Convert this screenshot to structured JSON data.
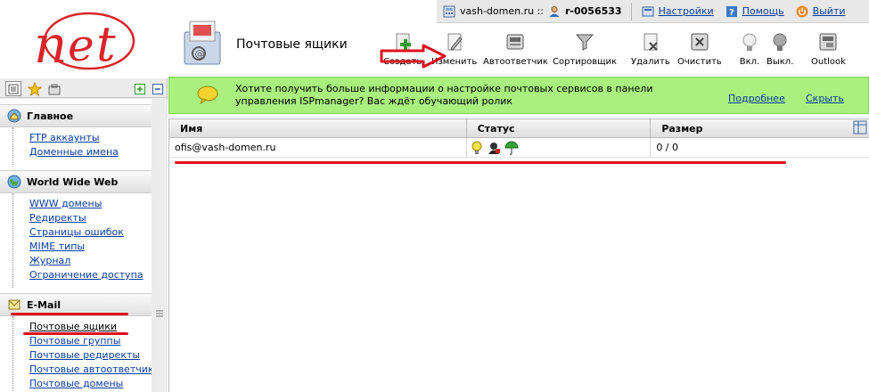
{
  "topbar": {
    "domain": "vash-domen.ru ::",
    "account": "r-0056533",
    "settings": "Настройки",
    "help": "Помощь",
    "logout": "Выйти"
  },
  "header": {
    "title": "Почтовые ящики"
  },
  "toolbar": {
    "create": "Создать",
    "edit": "Изменить",
    "autoresponder": "Автоответчик",
    "sorter": "Сортировщик",
    "delete": "Удалить",
    "clear": "Очистить",
    "enable": "Вкл.",
    "disable": "Выкл.",
    "outlook": "Outlook"
  },
  "sidebar": {
    "sections": [
      {
        "title": "Главное",
        "items": [
          "FTP аккаунты",
          "Доменные имена"
        ]
      },
      {
        "title": "World Wide Web",
        "items": [
          "WWW домены",
          "Редиректы",
          "Страницы ошибок",
          "MIME типы",
          "Журнал",
          "Ограничение доступа"
        ]
      },
      {
        "title": "E-Mail",
        "items": [
          "Почтовые ящики",
          "Почтовые группы",
          "Почтовые редиректы",
          "Почтовые автоответчики",
          "Почтовые домены"
        ]
      }
    ]
  },
  "banner": {
    "text": "Хотите получить больше информации о настройке почтовых сервисов в панели управления ISPmanager? Вас ждёт обучающий ролик",
    "more": "Подробнее",
    "hide": "Скрыть"
  },
  "table": {
    "columns": [
      "Имя",
      "Статус",
      "Размер"
    ],
    "rows": [
      {
        "name": "ofis@vash-domen.ru",
        "size": "0 / 0"
      }
    ]
  },
  "colors": {
    "banner": "#a9f07f",
    "annotation": "#e0101e",
    "link": "#0a3ca0"
  }
}
